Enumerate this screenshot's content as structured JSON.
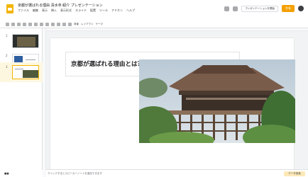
{
  "app": {
    "title": "京都が選ばれる理由 清水寺 紹介 プレゼンテーション",
    "menu": [
      "ファイル",
      "編集",
      "表示",
      "挿入",
      "表示形式",
      "スライド",
      "配置",
      "ツール",
      "アドオン",
      "ヘルプ"
    ],
    "present_label": "プレゼンテーションを開始",
    "share_label": "共有"
  },
  "toolbar": {
    "layout_label": "背景",
    "theme_label": "レイアウト",
    "transition_label": "テーマ"
  },
  "filmstrip": {
    "slides": [
      {
        "number": "1"
      },
      {
        "number": "2"
      },
      {
        "number": "3"
      }
    ]
  },
  "slide": {
    "title": "京都が選ばれる理由とは？"
  },
  "notes": {
    "placeholder": "クリックするとスピーカーノートを追加できます"
  },
  "bottom": {
    "grid_label": "■■",
    "explore_label": "データ探索"
  }
}
